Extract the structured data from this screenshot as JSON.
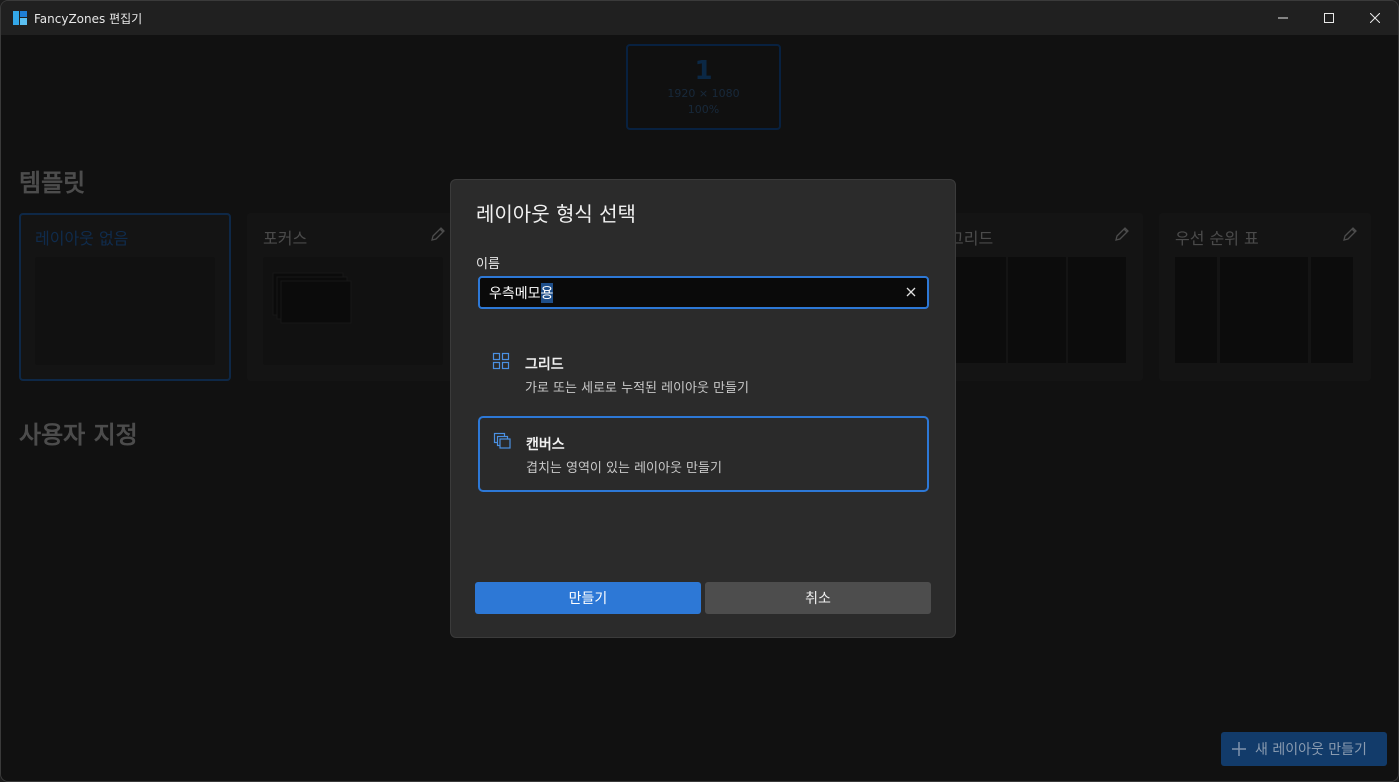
{
  "window": {
    "title": "FancyZones 편집기",
    "controls": {
      "minimize": "—",
      "maximize": "☐",
      "close": "✕"
    }
  },
  "monitor": {
    "number": "1",
    "resolution": "1920 × 1080",
    "scale": "100%"
  },
  "sections": {
    "templates": "템플릿",
    "custom": "사용자 지정"
  },
  "templates": [
    {
      "label": "레이아웃 없음",
      "selected": true
    },
    {
      "label": "포커스",
      "editable": true
    },
    {
      "label": "그리드",
      "editable": true
    },
    {
      "label": "우선 순위 표",
      "editable": true
    }
  ],
  "new_layout_button": {
    "icon": "plus-icon",
    "label": "새 레이아웃 만들기"
  },
  "dialog": {
    "title": "레이아웃 형식 선택",
    "name_label": "이름",
    "name_value_prefix": "우측메모",
    "name_value_selected": "용",
    "options": [
      {
        "icon": "grid-icon",
        "title": "그리드",
        "description": "가로 또는 세로로 누적된 레이아웃 만들기",
        "selected": false
      },
      {
        "icon": "canvas-icon",
        "title": "캔버스",
        "description": "겹치는 영역이 있는 레이아웃 만들기",
        "selected": true
      }
    ],
    "create_label": "만들기",
    "cancel_label": "취소"
  },
  "colors": {
    "accent": "#2d78d6",
    "background": "#202020",
    "dialog": "#2b2b2b"
  }
}
